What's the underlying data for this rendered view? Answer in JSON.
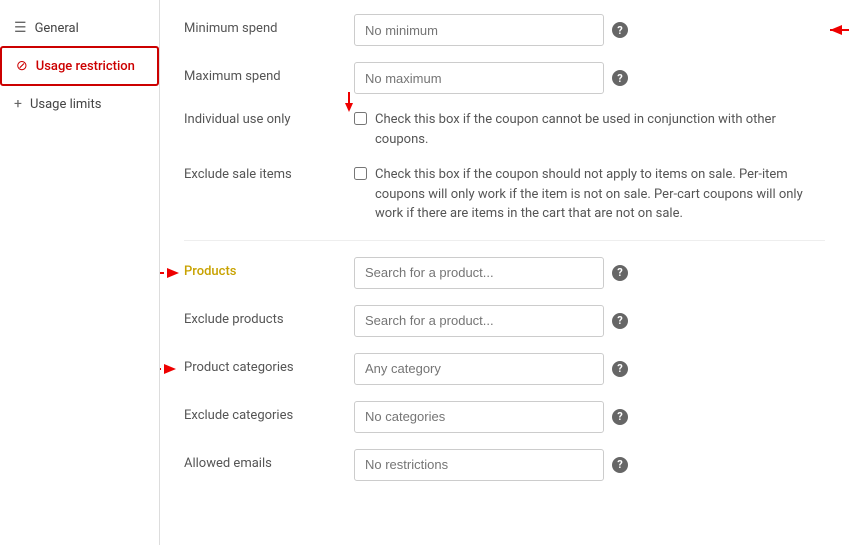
{
  "sidebar": {
    "items": [
      {
        "id": "general",
        "label": "General",
        "icon": "≡"
      },
      {
        "id": "usage-restriction",
        "label": "Usage restriction",
        "icon": "⊘",
        "active": true
      },
      {
        "id": "usage-limits",
        "label": "Usage limits",
        "icon": "+"
      }
    ]
  },
  "form": {
    "minimum_spend": {
      "label": "Minimum spend",
      "placeholder": "No minimum"
    },
    "maximum_spend": {
      "label": "Maximum spend",
      "placeholder": "No maximum"
    },
    "individual_use": {
      "label": "Individual use only",
      "description": "Check this box if the coupon cannot be used in conjunction with other coupons."
    },
    "exclude_sale": {
      "label": "Exclude sale items",
      "description": "Check this box if the coupon should not apply to items on sale. Per-item coupons will only work if the item is not on sale. Per-cart coupons will only work if there are items in the cart that are not on sale."
    },
    "products": {
      "label": "Products",
      "placeholder": "Search for a product..."
    },
    "exclude_products": {
      "label": "Exclude products",
      "placeholder": "Search for a product..."
    },
    "product_categories": {
      "label": "Product categories",
      "placeholder": "Any category"
    },
    "exclude_categories": {
      "label": "Exclude categories",
      "placeholder": "No categories"
    },
    "allowed_emails": {
      "label": "Allowed emails",
      "placeholder": "No restrictions"
    }
  },
  "help_icon": "?"
}
